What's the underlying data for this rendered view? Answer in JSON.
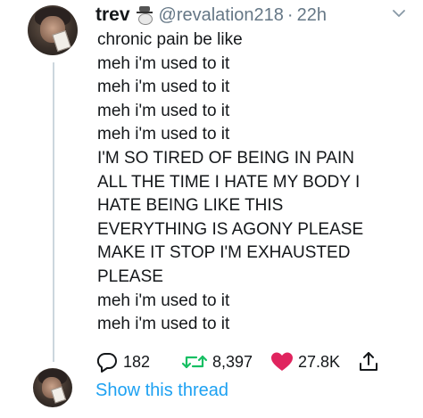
{
  "tweet": {
    "author": {
      "name": "trev",
      "name_emoji_icon": "cowboy-emoji",
      "handle": "@revalation218",
      "separator": "·",
      "time": "22h"
    },
    "lines": [
      "chronic pain be like",
      "meh i'm used to it",
      "meh i'm used to it",
      "meh i'm used to it",
      "meh i'm used to it",
      "I'M SO TIRED OF BEING IN PAIN",
      "ALL THE TIME I HATE MY BODY I",
      "HATE BEING LIKE THIS",
      "EVERYTHING IS AGONY PLEASE",
      "MAKE IT STOP I'M EXHAUSTED",
      "PLEASE",
      "meh i'm used to it",
      "meh i'm used to it"
    ],
    "actions": {
      "replies": "182",
      "retweets": "8,397",
      "likes": "27.8K"
    },
    "show_thread": "Show this thread"
  },
  "colors": {
    "text": "#14171a",
    "muted": "#657786",
    "link": "#1da1f2",
    "retweet": "#17bf63",
    "like": "#e0245e",
    "thread_line": "#ccd6dd"
  }
}
